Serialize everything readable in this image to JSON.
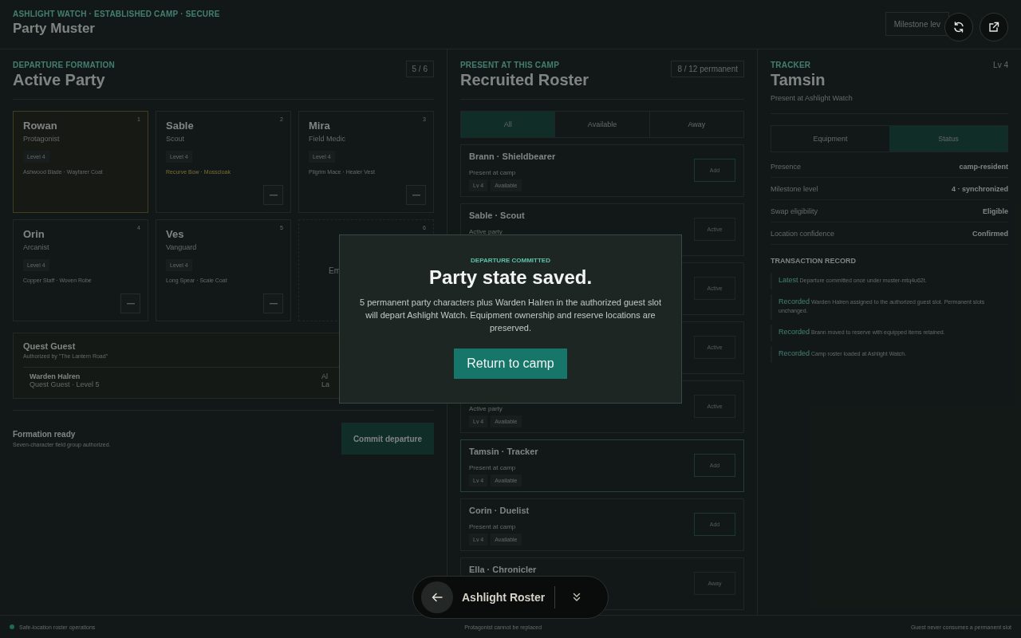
{
  "header": {
    "eyebrow": "ASHLIGHT WATCH · ESTABLISHED CAMP · SECURE",
    "title": "Party Muster",
    "milestone_button": "Milestone lev"
  },
  "formation": {
    "eyebrow": "DEPARTURE FORMATION",
    "title": "Active Party",
    "count": "5 / 6",
    "slots": [
      {
        "kind": "member",
        "number": "1",
        "name": "Rowan",
        "role": "Protagonist",
        "level": "Level 4",
        "gear": "Ashwood Blade · Wayfarer Coat",
        "protagonist": true,
        "gear_accent": false
      },
      {
        "kind": "member",
        "number": "2",
        "name": "Sable",
        "role": "Scout",
        "level": "Level 4",
        "gear": "Recurve Bow · Mosscloak",
        "protagonist": false,
        "gear_accent": true
      },
      {
        "kind": "member",
        "number": "3",
        "name": "Mira",
        "role": "Field Medic",
        "level": "Level 4",
        "gear": "Pilgrim Mace · Healer Vest",
        "protagonist": false,
        "gear_accent": false
      },
      {
        "kind": "member",
        "number": "4",
        "name": "Orin",
        "role": "Arcanist",
        "level": "Level 4",
        "gear": "Copper Staff · Woven Robe",
        "protagonist": false,
        "gear_accent": false
      },
      {
        "kind": "member",
        "number": "5",
        "name": "Ves",
        "role": "Vanguard",
        "level": "Level 4",
        "gear": "Long Spear · Scale Coat",
        "protagonist": false,
        "gear_accent": false
      },
      {
        "kind": "empty",
        "number": "6",
        "label": "Em"
      }
    ],
    "guest": {
      "title": "Quest Guest",
      "subtitle": "Authorized by \"The Lantern Road\"",
      "name": "Warden Halren",
      "detail": "Quest Guest · Level 5",
      "side_lines": [
        "Al",
        "La"
      ]
    },
    "footer": {
      "title": "Formation ready",
      "subtitle": "Seven-character field group authorized.",
      "button": "Commit departure"
    }
  },
  "roster": {
    "eyebrow": "PRESENT AT THIS CAMP",
    "title": "Recruited Roster",
    "count": "8 / 12 permanent",
    "tabs": [
      {
        "label": "All",
        "selected": true
      },
      {
        "label": "Available",
        "selected": false
      },
      {
        "label": "Away",
        "selected": false
      }
    ],
    "rows": [
      {
        "name": "Brann · Shieldbearer",
        "status": "Present at camp",
        "chips": [
          "Lv 4",
          "Available"
        ],
        "action": "Add",
        "kind": "add",
        "selected": false
      },
      {
        "name": "Sable · Scout",
        "status": "Active party",
        "chips": [],
        "action": "Active",
        "kind": "muted",
        "selected": false
      },
      {
        "chips": [],
        "action": "Active",
        "kind": "muted",
        "selected": false
      },
      {
        "chips": [],
        "action": "Active",
        "kind": "muted",
        "selected": false
      },
      {
        "status": "Active party",
        "chips": [
          "Lv 4",
          "Available"
        ],
        "action": "Active",
        "kind": "muted",
        "selected": false
      },
      {
        "name": "Tamsin · Tracker",
        "status": "Present at camp",
        "chips": [
          "Lv 4",
          "Available"
        ],
        "action": "Add",
        "kind": "add",
        "selected": true
      },
      {
        "name": "Corin · Duelist",
        "status": "Present at camp",
        "chips": [
          "Lv 4",
          "Available"
        ],
        "action": "Add",
        "kind": "add",
        "selected": false
      },
      {
        "name": "Ella · Chronicler",
        "chips": [],
        "action": "Away",
        "kind": "muted",
        "selected": false
      }
    ]
  },
  "tracker": {
    "eyebrow": "TRACKER",
    "level": "Lv 4",
    "name": "Tamsin",
    "subtitle": "Present at Ashlight Watch",
    "tabs": [
      {
        "label": "Equipment",
        "selected": false
      },
      {
        "label": "Status",
        "selected": true
      }
    ],
    "stats": [
      {
        "label": "Presence",
        "value": "camp-resident"
      },
      {
        "label": "Milestone level",
        "value": "4 · synchronized"
      },
      {
        "label": "Swap eligibility",
        "value": "Eligible"
      },
      {
        "label": "Location confidence",
        "value": "Confirmed"
      }
    ],
    "record_title": "TRANSACTION RECORD",
    "records": [
      {
        "tag": "Latest",
        "text": "Departure committed once under muster-mtq4u62t."
      },
      {
        "tag": "Recorded",
        "text": "Warden Halren assigned to the authorized guest slot. Permanent slots unchanged."
      },
      {
        "tag": "Recorded",
        "text": "Brann moved to reserve with equipped items retained."
      },
      {
        "tag": "Recorded",
        "text": "Camp roster loaded at Ashlight Watch."
      }
    ]
  },
  "status_bar": {
    "left": {
      "text": "Safe-location roster operations",
      "color": "#1f6b4c"
    },
    "center": "Protagonist cannot be replaced",
    "right": "Guest never consumes a permanent slot"
  },
  "modal": {
    "eyebrow": "DEPARTURE COMMITTED",
    "title": "Party state saved.",
    "body": "5 permanent party characters plus Warden Halren in the authorized guest slot will depart Ashlight Watch. Equipment ownership and reserve locations are preserved.",
    "button": "Return to camp"
  },
  "dock": {
    "title": "Ashlight Roster"
  }
}
